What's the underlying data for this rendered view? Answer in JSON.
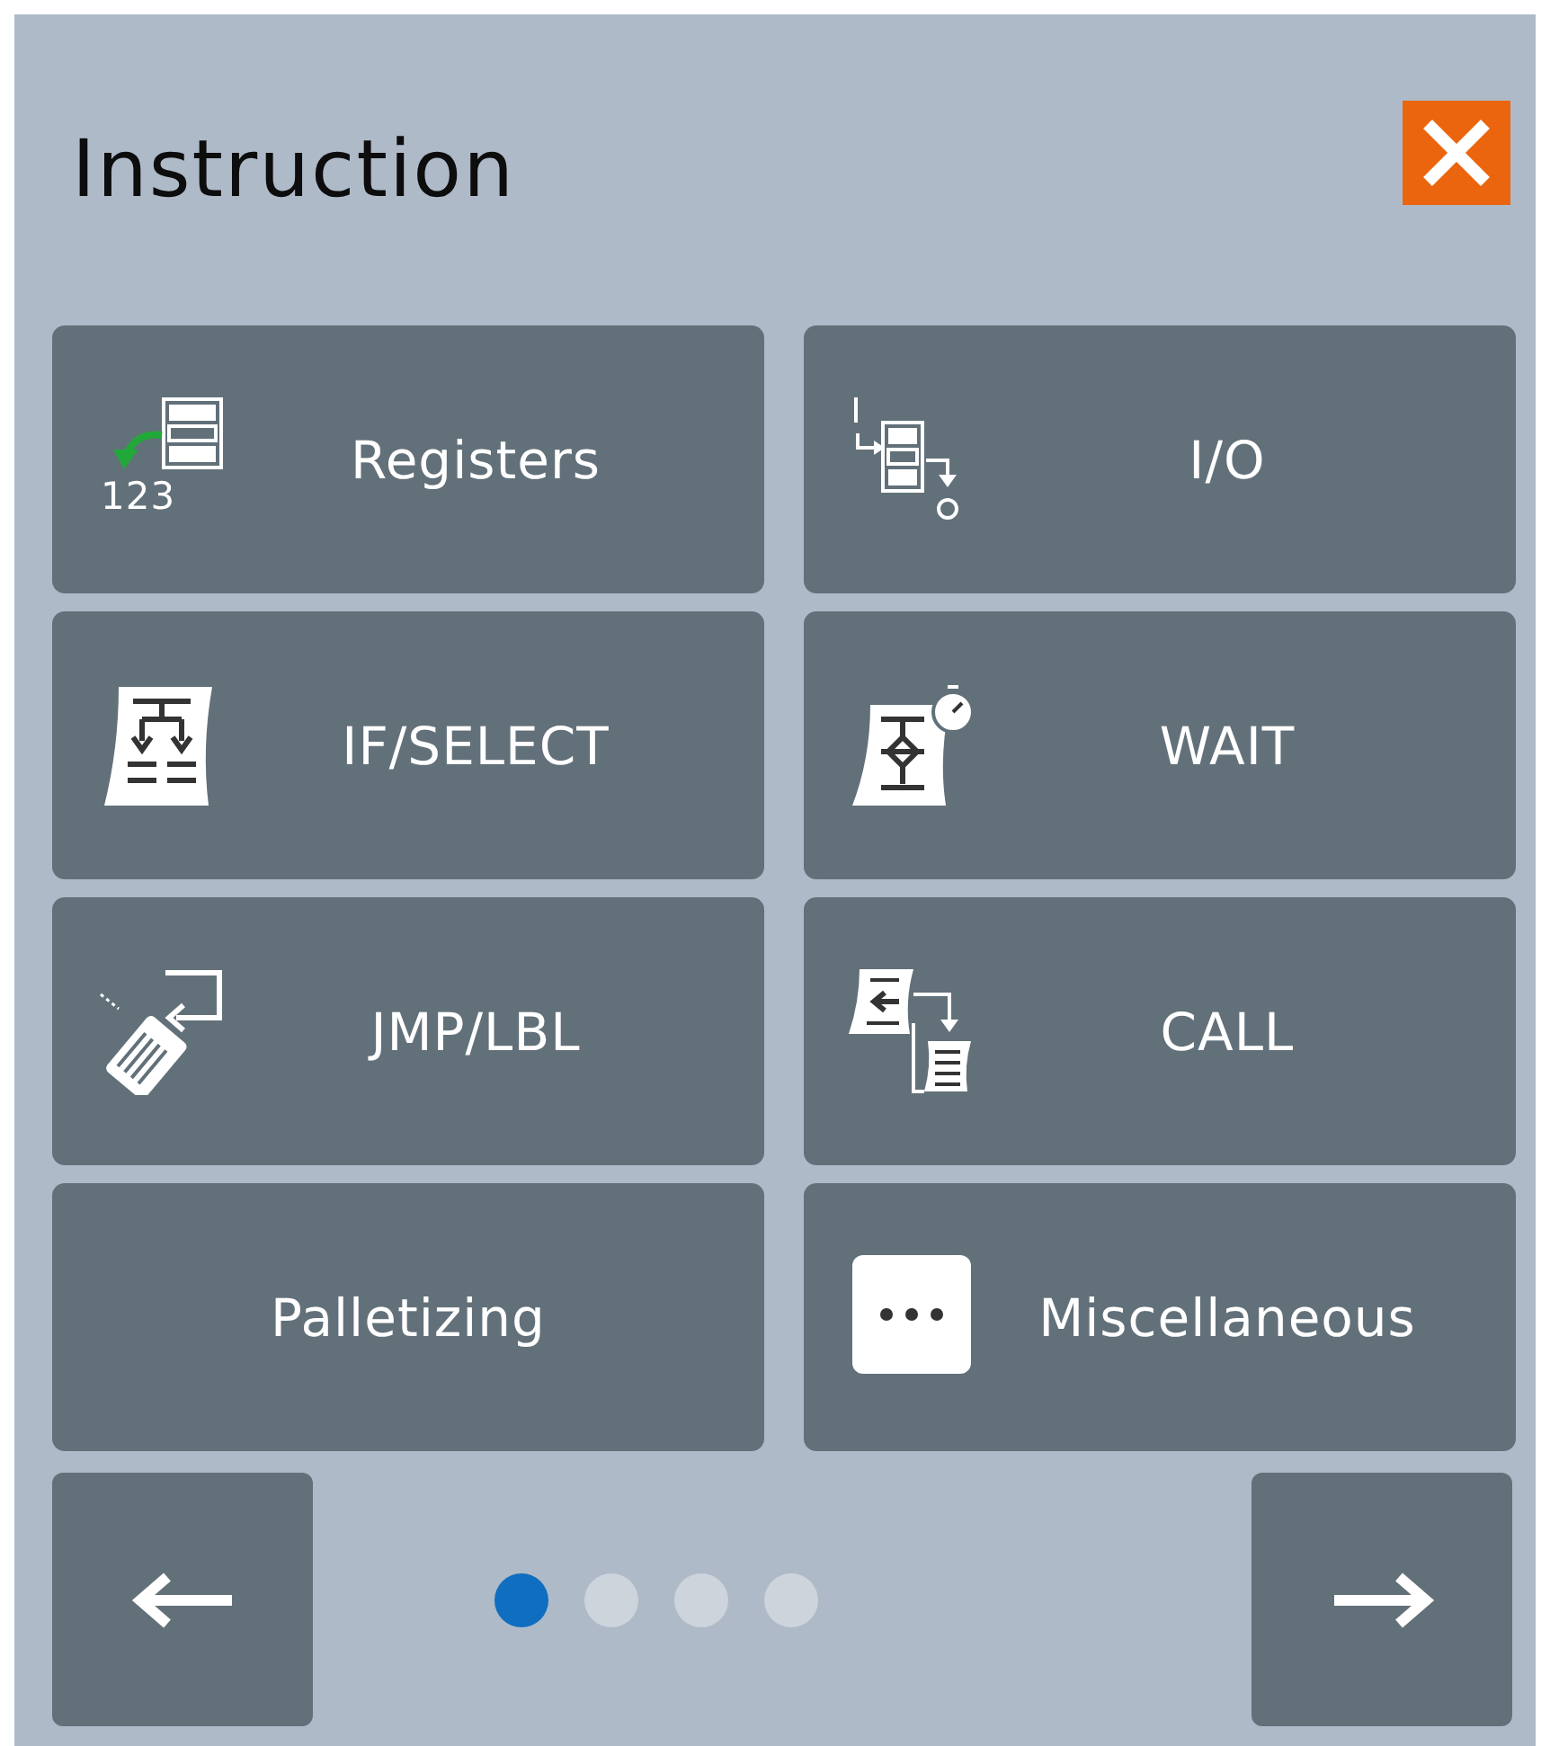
{
  "dialog": {
    "title": "Instruction"
  },
  "items": [
    {
      "label": "Registers",
      "kind": "registers",
      "icon_text": "123"
    },
    {
      "label": "I/O",
      "kind": "io"
    },
    {
      "label": "IF/SELECT",
      "kind": "branch"
    },
    {
      "label": "WAIT",
      "kind": "wait"
    },
    {
      "label": "JMP/LBL",
      "kind": "jump"
    },
    {
      "label": "CALL",
      "kind": "call"
    },
    {
      "label": "Palletizing",
      "kind": "plain"
    },
    {
      "label": "Miscellaneous",
      "kind": "more"
    }
  ],
  "pages": [
    {
      "selected": true
    },
    {
      "selected": false
    },
    {
      "selected": false
    },
    {
      "selected": false
    }
  ]
}
